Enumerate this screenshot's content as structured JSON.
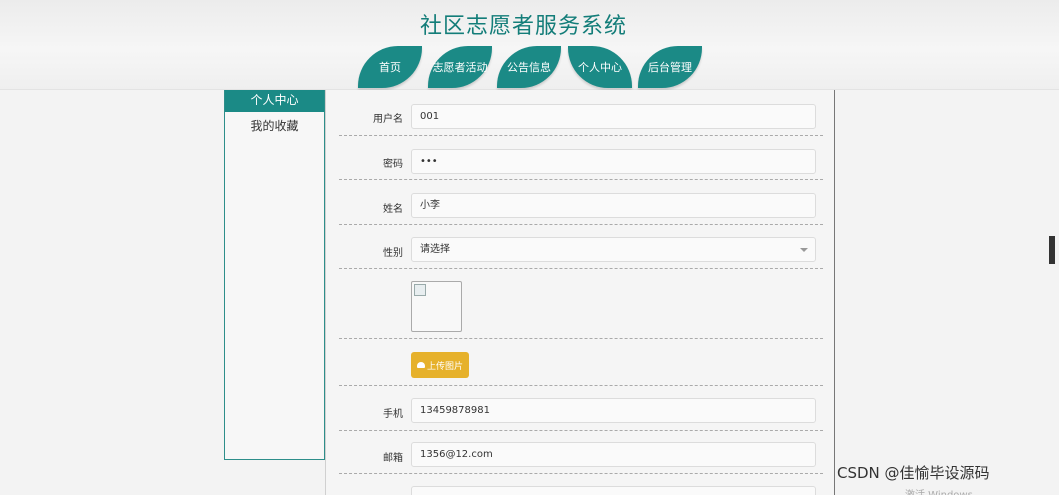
{
  "header": {
    "title": "社区志愿者服务系统",
    "nav": [
      {
        "label": "首页"
      },
      {
        "label": "志愿者活动"
      },
      {
        "label": "公告信息"
      },
      {
        "label": "个人中心"
      },
      {
        "label": "后台管理"
      }
    ]
  },
  "sidebar": {
    "items": [
      {
        "label": "个人中心"
      },
      {
        "label": "我的收藏"
      }
    ]
  },
  "form": {
    "username": {
      "label": "用户名",
      "value": "001"
    },
    "password": {
      "label": "密码",
      "value": "•••"
    },
    "name": {
      "label": "姓名",
      "value": "小李"
    },
    "gender": {
      "label": "性别",
      "value": "请选择"
    },
    "upload_label": "上传图片",
    "phone": {
      "label": "手机",
      "value": "13459878981"
    },
    "email": {
      "label": "邮箱",
      "value": "1356@12.com"
    }
  },
  "watermark": "CSDN @佳愉毕设源码",
  "activate_text": "激活 Windows",
  "colors": {
    "accent": "#1b8a86",
    "title": "#137d79",
    "upload": "#e6b12b"
  }
}
